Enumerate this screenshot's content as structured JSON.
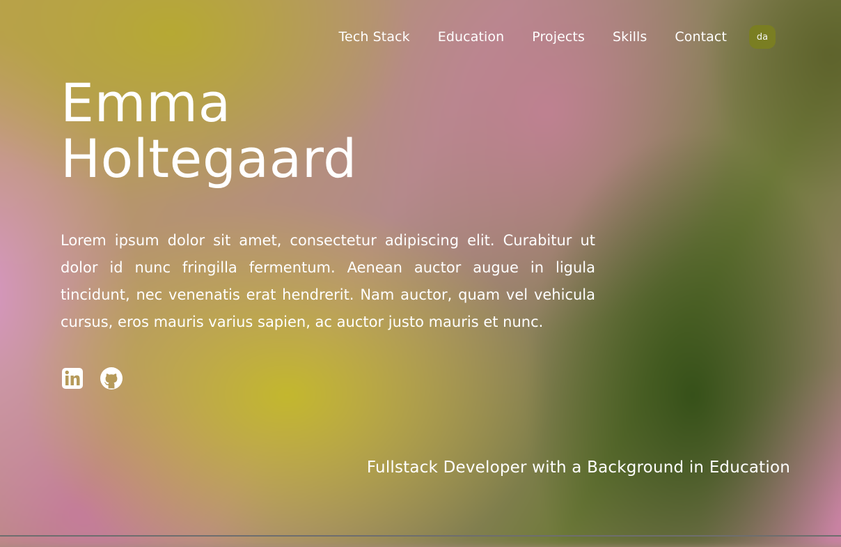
{
  "nav": {
    "items": [
      {
        "label": "Tech Stack"
      },
      {
        "label": "Education"
      },
      {
        "label": "Projects"
      },
      {
        "label": "Skills"
      },
      {
        "label": "Contact"
      }
    ],
    "language_button": "da"
  },
  "hero": {
    "first_name": "Emma",
    "last_name": "Holtegaard",
    "bio": "Lorem ipsum dolor sit amet, consectetur adipiscing elit. Curabitur ut dolor id nunc fringilla fermentum. Aenean auctor augue in ligula tincidunt, nec venenatis erat hendrerit. Nam auctor, quam vel vehicula cursus, eros mauris varius sapien, ac auctor justo mauris et nunc.",
    "socials": [
      {
        "icon": "linkedin-icon"
      },
      {
        "icon": "github-icon"
      }
    ]
  },
  "tagline": "Fullstack Developer with a Background in Education",
  "colors": {
    "text": "#ffffff",
    "language_button_bg": "#7a7e22"
  }
}
